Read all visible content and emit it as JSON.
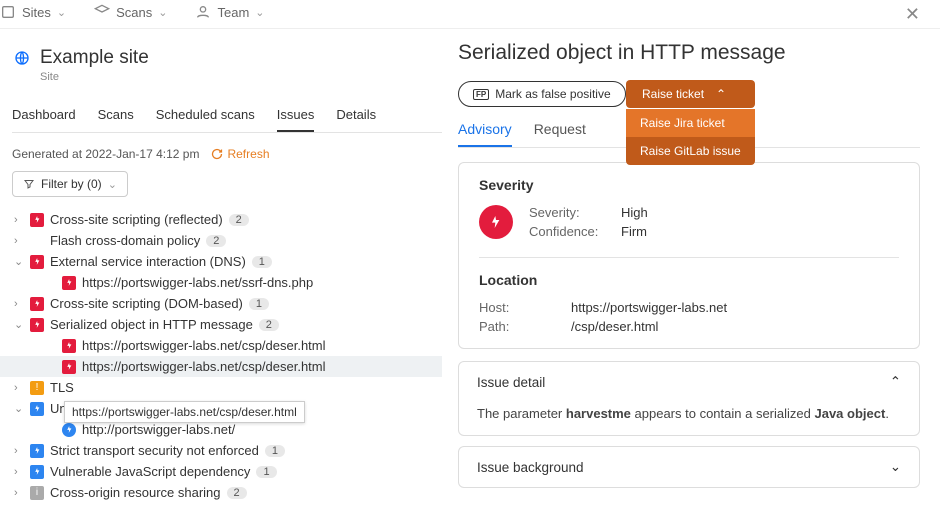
{
  "topnav": {
    "sites": "Sites",
    "scans": "Scans",
    "team": "Team"
  },
  "site": {
    "title": "Example site",
    "subtitle": "Site"
  },
  "tabs": [
    "Dashboard",
    "Scans",
    "Scheduled scans",
    "Issues",
    "Details"
  ],
  "active_tab": "Issues",
  "generated": "Generated at 2022-Jan-17 4:12 pm",
  "refresh": "Refresh",
  "filter": "Filter by (0)",
  "tree": [
    {
      "arrow": ">",
      "sev": "high",
      "label": "Cross-site scripting (reflected)",
      "count": "2"
    },
    {
      "arrow": ">",
      "sev": null,
      "label": "Flash cross-domain policy",
      "count": "2"
    },
    {
      "arrow": "v",
      "sev": "high",
      "label": "External service interaction (DNS)",
      "count": "1"
    },
    {
      "arrow": "",
      "sev": "high",
      "label": "https://portswigger-labs.net/ssrf-dns.php",
      "count": "",
      "lev": 1
    },
    {
      "arrow": ">",
      "sev": "high",
      "label": "Cross-site scripting (DOM-based)",
      "count": "1"
    },
    {
      "arrow": "v",
      "sev": "high",
      "label": "Serialized object in HTTP message",
      "count": "2"
    },
    {
      "arrow": "",
      "sev": "high",
      "label": "https://portswigger-labs.net/csp/deser.html",
      "count": "",
      "lev": 1
    },
    {
      "arrow": "",
      "sev": "high",
      "label": "https://portswigger-labs.net/csp/deser.html",
      "count": "",
      "lev": 1,
      "selected": true
    },
    {
      "arrow": ">",
      "sev": "med",
      "label": "TLS",
      "count": ""
    },
    {
      "arrow": "v",
      "sev": "low",
      "label": "Unencrypted communications",
      "count": "1"
    },
    {
      "arrow": "",
      "sev": "low",
      "label": "http://portswigger-labs.net/",
      "count": "",
      "lev": 1
    },
    {
      "arrow": ">",
      "sev": "low",
      "label": "Strict transport security not enforced",
      "count": "1"
    },
    {
      "arrow": ">",
      "sev": "low",
      "label": "Vulnerable JavaScript dependency",
      "count": "1"
    },
    {
      "arrow": ">",
      "sev": "info",
      "label": "Cross-origin resource sharing",
      "count": "2"
    }
  ],
  "tooltip": "https://portswigger-labs.net/csp/deser.html",
  "panel": {
    "title": "Serialized object in HTTP message",
    "fp_label": "Mark as false positive",
    "raise": "Raise ticket",
    "raise_options": [
      "Raise Jira ticket",
      "Raise GitLab issue"
    ],
    "tabs": [
      "Advisory",
      "Request"
    ],
    "severity": {
      "heading": "Severity",
      "sev_label": "Severity:",
      "sev_val": "High",
      "conf_label": "Confidence:",
      "conf_val": "Firm"
    },
    "location": {
      "heading": "Location",
      "host_label": "Host:",
      "host_val": "https://portswigger-labs.net",
      "path_label": "Path:",
      "path_val": "/csp/deser.html"
    },
    "issue_detail": {
      "heading": "Issue detail",
      "text_before": "The parameter ",
      "param": "harvestme",
      "text_mid": " appears to contain a serialized ",
      "obj": "Java object",
      "text_after": "."
    },
    "issue_bg": "Issue background"
  }
}
